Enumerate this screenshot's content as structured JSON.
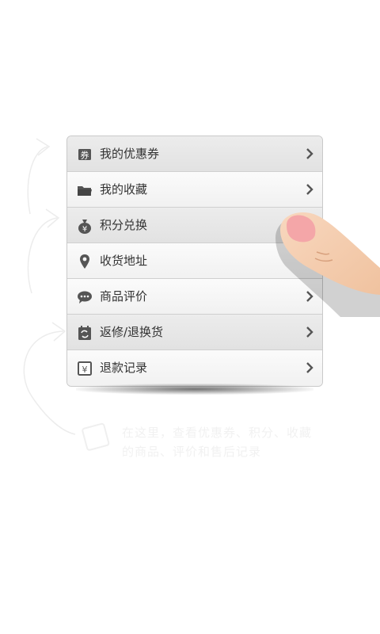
{
  "menu": {
    "items": [
      {
        "label": "我的优惠券",
        "icon": "coupon-icon",
        "selected": true
      },
      {
        "label": "我的收藏",
        "icon": "folder-icon",
        "selected": false
      },
      {
        "label": "积分兑换",
        "icon": "money-bag-icon",
        "selected": true
      },
      {
        "label": "收货地址",
        "icon": "location-pin-icon",
        "selected": false
      },
      {
        "label": "商品评价",
        "icon": "comment-icon",
        "selected": false
      },
      {
        "label": "返修/退换货",
        "icon": "return-exchange-icon",
        "selected": true
      },
      {
        "label": "退款记录",
        "icon": "refund-record-icon",
        "selected": false
      }
    ]
  },
  "hint": {
    "text": "在这里，查看优惠券、积分、收藏的商品、评价和售后记录"
  }
}
